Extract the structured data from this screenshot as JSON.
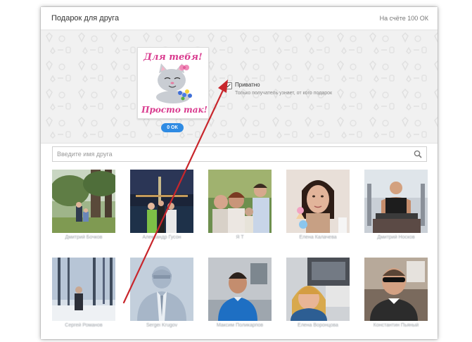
{
  "dialog": {
    "title": "Подарок для друга",
    "balance": "На счёте 100 ОК"
  },
  "gift": {
    "line1": "Для тебя!",
    "line2": "Просто так!",
    "price": "0 ОК",
    "private_label": "Приватно",
    "private_hint": "Только получатель узнает, от кого подарок",
    "private_checked": true
  },
  "search": {
    "placeholder": "Введите имя друга",
    "value": ""
  },
  "friends": [
    {
      "name": "Дмитрий Бочков"
    },
    {
      "name": "Александр Гусон"
    },
    {
      "name": "Я Т"
    },
    {
      "name": "Елена Калачева"
    },
    {
      "name": "Дмитрий Носков"
    },
    {
      "name": "Сергей Романов"
    },
    {
      "name": "Sergei Krugov"
    },
    {
      "name": "Максим Поликарпов"
    },
    {
      "name": "Елена Воронцова"
    },
    {
      "name": "Константин Пьяный"
    }
  ],
  "colors": {
    "accent": "#2f8be3",
    "arrow": "#c8262c",
    "pattern_bg": "#f1f1f1"
  }
}
